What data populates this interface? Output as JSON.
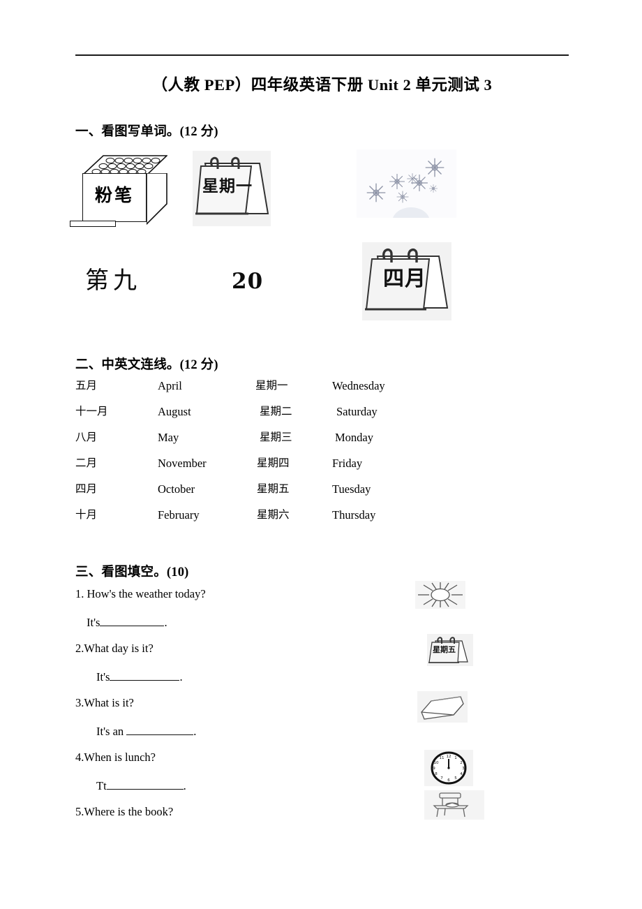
{
  "document": {
    "title": "（人教 PEP）四年级英语下册 Unit 2 单元测试 3"
  },
  "sections": {
    "one": {
      "heading": "一、看图写单词。(12 分)",
      "pictures": [
        {
          "name": "chalk-box",
          "label": "粉笔"
        },
        {
          "name": "calendar-monday",
          "label": "星期一"
        },
        {
          "name": "snowflakes",
          "label": ""
        },
        {
          "name": "ninth",
          "label": "第九"
        },
        {
          "name": "twenty",
          "label": "20"
        },
        {
          "name": "calendar-april",
          "label": "四月"
        }
      ]
    },
    "two": {
      "heading": "二、中英文连线。(12 分)",
      "rows": [
        {
          "cn_month": "五月",
          "en_month": "April",
          "cn_day": "星期一",
          "en_day": "Wednesday"
        },
        {
          "cn_month": "十一月",
          "en_month": "August",
          "cn_day": "星期二",
          "en_day": "Saturday"
        },
        {
          "cn_month": "八月",
          "en_month": "May",
          "cn_day": "星期三",
          "en_day": "Monday"
        },
        {
          "cn_month": "二月",
          "en_month": "November",
          "cn_day": "星期四",
          "en_day": "Friday"
        },
        {
          "cn_month": "四月",
          "en_month": "October",
          "cn_day": "星期五",
          "en_day": "Tuesday"
        },
        {
          "cn_month": "十月",
          "en_month": "February",
          "cn_day": "星期六",
          "en_day": "Thursday"
        }
      ]
    },
    "three": {
      "heading": "三、看图填空。(10)",
      "questions": [
        {
          "prompt": "1. How's the weather today?",
          "answer_prefix": "It's",
          "answer_suffix": ".",
          "picture": "sun"
        },
        {
          "prompt": "2.What day is it?",
          "answer_prefix": "It's",
          "answer_suffix": ".",
          "picture": "calendar-friday"
        },
        {
          "prompt": "3.What is it?",
          "answer_prefix": "It's an ",
          "answer_suffix": ".",
          "picture": "eraser"
        },
        {
          "prompt": "4.When is lunch?",
          "answer_prefix": "Tt",
          "answer_suffix": ".",
          "picture": "clock"
        },
        {
          "prompt": "5.Where is the book?",
          "answer_prefix": "",
          "answer_suffix": "",
          "picture": "desk-with-book"
        }
      ]
    }
  }
}
